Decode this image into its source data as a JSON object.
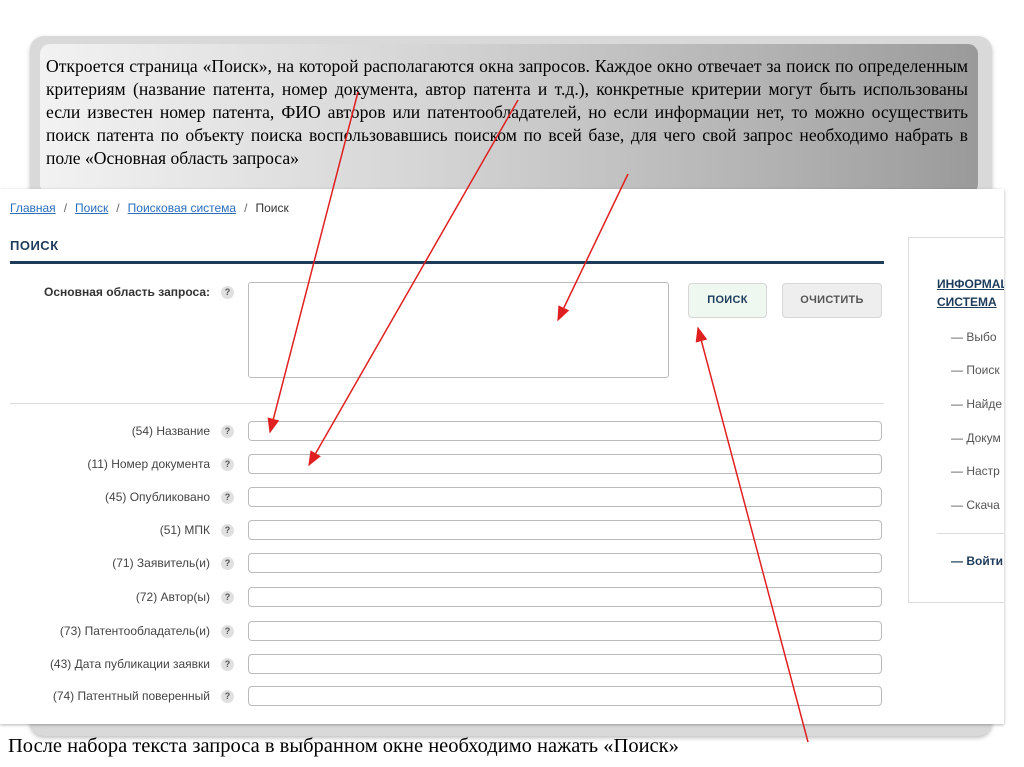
{
  "caption": {
    "top": "Откроется страница «Поиск», на которой располагаются окна запросов. Каждое окно отвечает за поиск по определенным критериям (название патента, номер документа, автор патента и т.д.), конкретные критерии могут быть использованы если известен номер патента, ФИО авторов или патентообладателей, но если информации нет, то можно осуществить поиск патента по объекту поиска воспользовавшись поиском по всей базе, для чего свой запрос необходимо набрать в поле «Основная область запроса»",
    "bottom": "После набора текста запроса в выбранном окне необходимо нажать «Поиск»"
  },
  "breadcrumb": {
    "items": [
      "Главная",
      "Поиск",
      "Поисковая система"
    ],
    "current": "Поиск",
    "separator": "/"
  },
  "page": {
    "title": "ПОИСК"
  },
  "main_query": {
    "label": "Основная область запроса:",
    "value": ""
  },
  "help_glyph": "?",
  "buttons": {
    "search": "ПОИСК",
    "clear": "ОЧИСТИТЬ"
  },
  "fields": [
    {
      "label": "(54) Название",
      "value": ""
    },
    {
      "label": "(11) Номер документа",
      "value": ""
    },
    {
      "label": "(45) Опубликовано",
      "value": ""
    },
    {
      "label": "(51) МПК",
      "value": ""
    },
    {
      "label": "(71) Заявитель(и)",
      "value": ""
    },
    {
      "label": "(72) Автор(ы)",
      "value": ""
    },
    {
      "label": "(73) Патентообладатель(и)",
      "value": ""
    },
    {
      "label": "(43) Дата публикации заявки",
      "value": ""
    },
    {
      "label": "(74) Патентный поверенный",
      "value": ""
    }
  ],
  "sidebar": {
    "title_line1": "ИНФОРМАЦ",
    "title_line2": "СИСТЕМА",
    "items": [
      "— Выбо",
      "— Поиск",
      "— Найде",
      "— Докум",
      "— Настр",
      "— Скача"
    ],
    "login": "— Войти"
  },
  "colors": {
    "accent": "#1e3b5a",
    "link": "#2a6ebb",
    "arrow": "#e02020",
    "search_button_bg": "#eef8f1"
  }
}
